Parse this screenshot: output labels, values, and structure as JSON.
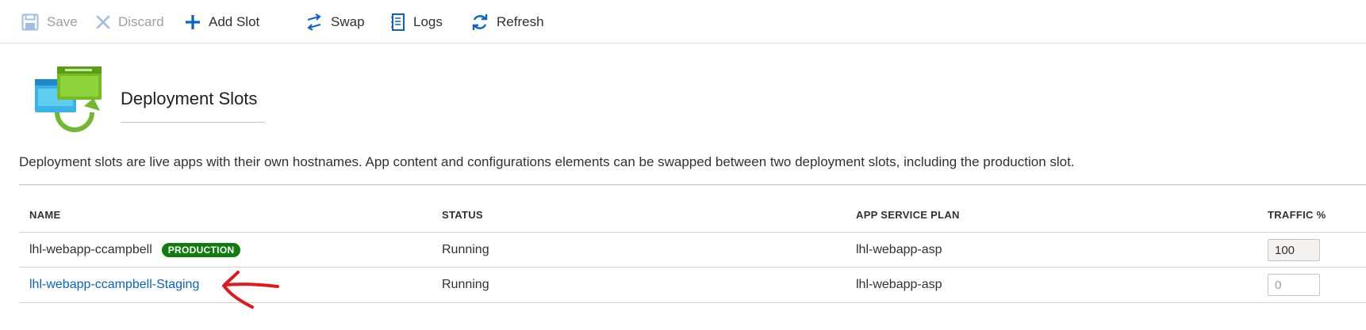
{
  "toolbar": {
    "save": {
      "label": "Save",
      "icon": "save-icon"
    },
    "discard": {
      "label": "Discard",
      "icon": "close-icon"
    },
    "add_slot": {
      "label": "Add Slot",
      "icon": "plus-icon"
    },
    "swap": {
      "label": "Swap",
      "icon": "swap-icon"
    },
    "logs": {
      "label": "Logs",
      "icon": "notebook-icon"
    },
    "refresh": {
      "label": "Refresh",
      "icon": "refresh-icon"
    }
  },
  "header": {
    "title": "Deployment Slots",
    "icon": "deployment-slots-icon"
  },
  "description": "Deployment slots are live apps with their own hostnames. App content and configurations elements can be swapped between two deployment slots, including the production slot.",
  "table": {
    "columns": [
      "NAME",
      "STATUS",
      "APP SERVICE PLAN",
      "TRAFFIC %"
    ],
    "rows": [
      {
        "name": "lhl-webapp-ccampbell",
        "badge": "PRODUCTION",
        "status": "Running",
        "plan": "lhl-webapp-asp",
        "traffic": "100",
        "traffic_placeholder": ""
      },
      {
        "name": "lhl-webapp-ccampbell-Staging",
        "badge": "",
        "status": "Running",
        "plan": "lhl-webapp-asp",
        "traffic": "",
        "traffic_placeholder": "0"
      }
    ]
  },
  "colors": {
    "accent": "#0b63c4",
    "production_badge": "#107c10",
    "annotation_arrow": "#e0191b"
  }
}
